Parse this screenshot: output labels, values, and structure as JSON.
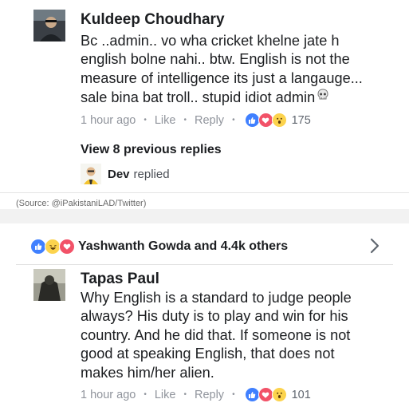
{
  "comment1": {
    "author": "Kuldeep Choudhary",
    "lines": [
      "Bc ..admin.. vo wha cricket khelne jate h",
      "english bolne nahi.. btw. English is not the",
      "measure of intelligence its just a langauge...",
      "sale bina bat troll.. stupid idiot admin"
    ],
    "time": "1 hour ago",
    "like": "Like",
    "reply": "Reply",
    "reaction_count": "175",
    "reaction_icons": [
      "like-icon",
      "love-icon",
      "wow-icon"
    ],
    "trailing_emoji_icon": "skull-icon"
  },
  "replies": {
    "view_label": "View 8 previous replies",
    "last_reply_name": "Dev",
    "last_reply_verb": "replied"
  },
  "source_caption": "(Source: @iPakistaniLAD/Twitter)",
  "post_reactions": {
    "text": "Yashwanth Gowda and 4.4k others",
    "icons": [
      "like-icon",
      "haha-icon",
      "love-icon"
    ]
  },
  "comment2": {
    "author": "Tapas Paul",
    "lines": [
      "Why English is a standard to judge people",
      "always? His duty is to play and win for his",
      "country. And he did that. If someone is not",
      "good at speaking English, that does not",
      "makes him/her alien."
    ],
    "time": "1 hour ago",
    "like": "Like",
    "reply": "Reply",
    "reaction_count": "101",
    "reaction_icons": [
      "like-icon",
      "love-icon",
      "wow-icon"
    ]
  },
  "colors": {
    "like_blue": "#4080ff",
    "love_red": "#f25268",
    "wow_yellow": "#fcd34d",
    "meta_gray": "#90949c"
  }
}
